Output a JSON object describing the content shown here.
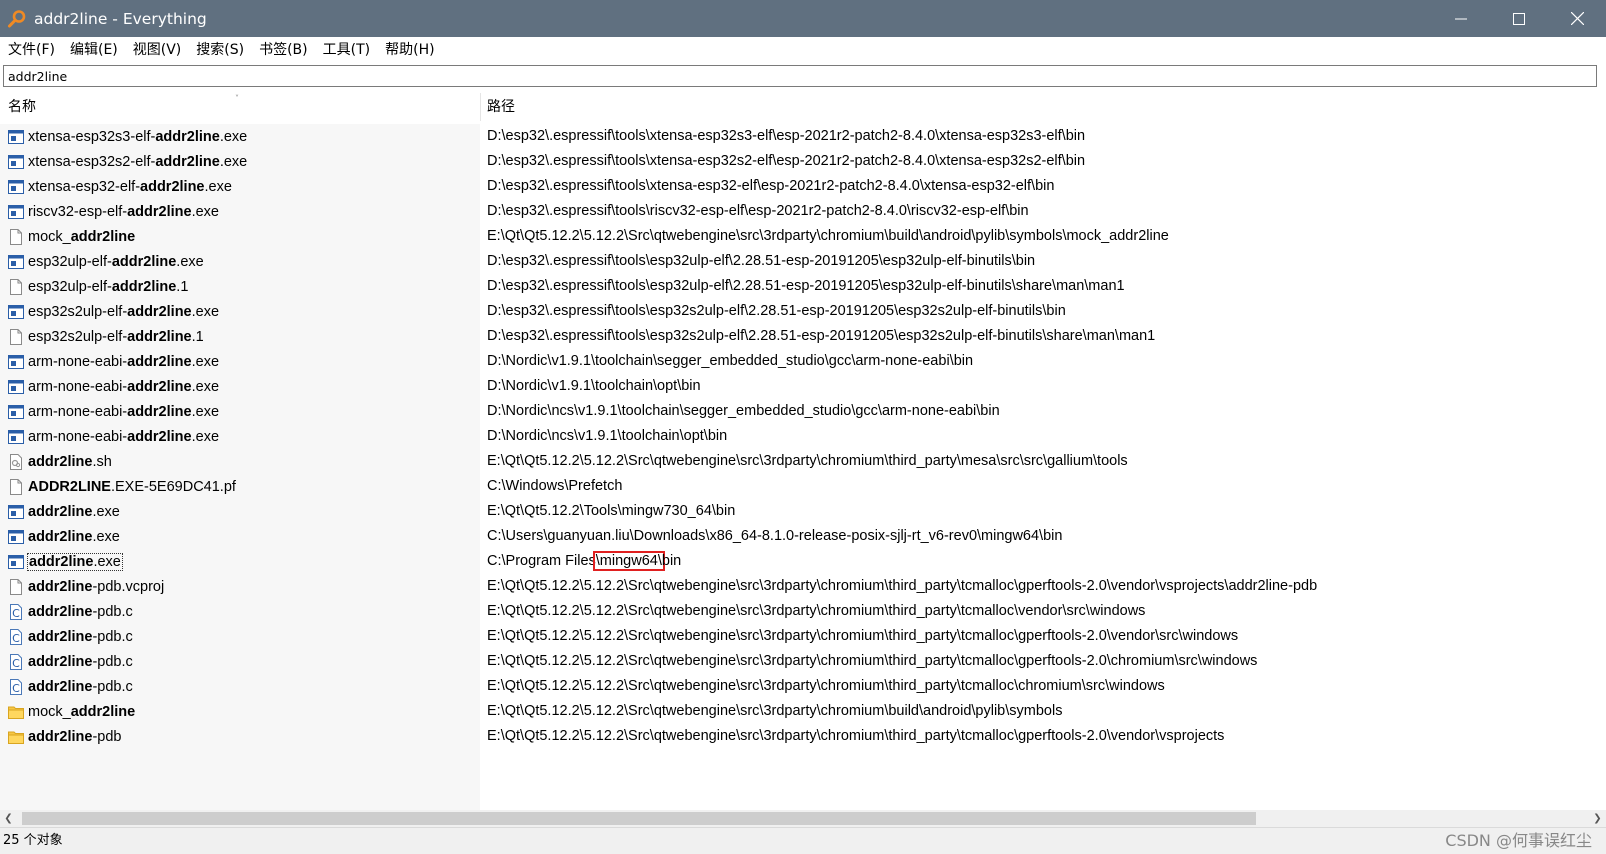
{
  "window": {
    "title": "addr2line - Everything"
  },
  "menu": [
    {
      "label": "文件(F)"
    },
    {
      "label": "编辑(E)"
    },
    {
      "label": "视图(V)"
    },
    {
      "label": "搜索(S)"
    },
    {
      "label": "书签(B)"
    },
    {
      "label": "工具(T)"
    },
    {
      "label": "帮助(H)"
    }
  ],
  "search": {
    "value": "addr2line"
  },
  "columns": {
    "name": "名称",
    "path": "路径"
  },
  "rows": [
    {
      "icon": "exe",
      "pre": "xtensa-esp32s3-elf-",
      "match": "addr2line",
      "post": ".exe",
      "path": "D:\\esp32\\.espressif\\tools\\xtensa-esp32s3-elf\\esp-2021r2-patch2-8.4.0\\xtensa-esp32s3-elf\\bin"
    },
    {
      "icon": "exe",
      "pre": "xtensa-esp32s2-elf-",
      "match": "addr2line",
      "post": ".exe",
      "path": "D:\\esp32\\.espressif\\tools\\xtensa-esp32s2-elf\\esp-2021r2-patch2-8.4.0\\xtensa-esp32s2-elf\\bin"
    },
    {
      "icon": "exe",
      "pre": "xtensa-esp32-elf-",
      "match": "addr2line",
      "post": ".exe",
      "path": "D:\\esp32\\.espressif\\tools\\xtensa-esp32-elf\\esp-2021r2-patch2-8.4.0\\xtensa-esp32-elf\\bin"
    },
    {
      "icon": "exe",
      "pre": "riscv32-esp-elf-",
      "match": "addr2line",
      "post": ".exe",
      "path": "D:\\esp32\\.espressif\\tools\\riscv32-esp-elf\\esp-2021r2-patch2-8.4.0\\riscv32-esp-elf\\bin"
    },
    {
      "icon": "file",
      "pre": "mock_",
      "match": "addr2line",
      "post": "",
      "path": "E:\\Qt\\Qt5.12.2\\5.12.2\\Src\\qtwebengine\\src\\3rdparty\\chromium\\build\\android\\pylib\\symbols\\mock_addr2line"
    },
    {
      "icon": "exe",
      "pre": "esp32ulp-elf-",
      "match": "addr2line",
      "post": ".exe",
      "path": "D:\\esp32\\.espressif\\tools\\esp32ulp-elf\\2.28.51-esp-20191205\\esp32ulp-elf-binutils\\bin"
    },
    {
      "icon": "file",
      "pre": "esp32ulp-elf-",
      "match": "addr2line",
      "post": ".1",
      "path": "D:\\esp32\\.espressif\\tools\\esp32ulp-elf\\2.28.51-esp-20191205\\esp32ulp-elf-binutils\\share\\man\\man1"
    },
    {
      "icon": "exe",
      "pre": "esp32s2ulp-elf-",
      "match": "addr2line",
      "post": ".exe",
      "path": "D:\\esp32\\.espressif\\tools\\esp32s2ulp-elf\\2.28.51-esp-20191205\\esp32s2ulp-elf-binutils\\bin"
    },
    {
      "icon": "file",
      "pre": "esp32s2ulp-elf-",
      "match": "addr2line",
      "post": ".1",
      "path": "D:\\esp32\\.espressif\\tools\\esp32s2ulp-elf\\2.28.51-esp-20191205\\esp32s2ulp-elf-binutils\\share\\man\\man1"
    },
    {
      "icon": "exe",
      "pre": "arm-none-eabi-",
      "match": "addr2line",
      "post": ".exe",
      "path": "D:\\Nordic\\v1.9.1\\toolchain\\segger_embedded_studio\\gcc\\arm-none-eabi\\bin"
    },
    {
      "icon": "exe",
      "pre": "arm-none-eabi-",
      "match": "addr2line",
      "post": ".exe",
      "path": "D:\\Nordic\\v1.9.1\\toolchain\\opt\\bin"
    },
    {
      "icon": "exe",
      "pre": "arm-none-eabi-",
      "match": "addr2line",
      "post": ".exe",
      "path": "D:\\Nordic\\ncs\\v1.9.1\\toolchain\\segger_embedded_studio\\gcc\\arm-none-eabi\\bin"
    },
    {
      "icon": "exe",
      "pre": "arm-none-eabi-",
      "match": "addr2line",
      "post": ".exe",
      "path": "D:\\Nordic\\ncs\\v1.9.1\\toolchain\\opt\\bin"
    },
    {
      "icon": "script",
      "pre": "",
      "match": "addr2line",
      "post": ".sh",
      "path": "E:\\Qt\\Qt5.12.2\\5.12.2\\Src\\qtwebengine\\src\\3rdparty\\chromium\\third_party\\mesa\\src\\src\\gallium\\tools"
    },
    {
      "icon": "file",
      "pre": "",
      "match": "ADDR2LINE",
      "post": ".EXE-5E69DC41.pf",
      "path": "C:\\Windows\\Prefetch"
    },
    {
      "icon": "exe",
      "pre": "",
      "match": "addr2line",
      "post": ".exe",
      "path": "E:\\Qt\\Qt5.12.2\\Tools\\mingw730_64\\bin"
    },
    {
      "icon": "exe",
      "pre": "",
      "match": "addr2line",
      "post": ".exe",
      "path": "C:\\Users\\guanyuan.liu\\Downloads\\x86_64-8.1.0-release-posix-sjlj-rt_v6-rev0\\mingw64\\bin"
    },
    {
      "icon": "exe",
      "pre": "",
      "match": "addr2line",
      "post": ".exe",
      "focused": true,
      "path": "C:\\Program Files\\mingw64\\bin",
      "path_pre": "C:\\Program Files",
      "path_hl": "\\mingw64\\",
      "path_post": "bin"
    },
    {
      "icon": "file",
      "pre": "",
      "match": "addr2line",
      "post": "-pdb.vcproj",
      "path": "E:\\Qt\\Qt5.12.2\\5.12.2\\Src\\qtwebengine\\src\\3rdparty\\chromium\\third_party\\tcmalloc\\gperftools-2.0\\vendor\\vsprojects\\addr2line-pdb"
    },
    {
      "icon": "c",
      "pre": "",
      "match": "addr2line",
      "post": "-pdb.c",
      "path": "E:\\Qt\\Qt5.12.2\\5.12.2\\Src\\qtwebengine\\src\\3rdparty\\chromium\\third_party\\tcmalloc\\vendor\\src\\windows"
    },
    {
      "icon": "c",
      "pre": "",
      "match": "addr2line",
      "post": "-pdb.c",
      "path": "E:\\Qt\\Qt5.12.2\\5.12.2\\Src\\qtwebengine\\src\\3rdparty\\chromium\\third_party\\tcmalloc\\gperftools-2.0\\vendor\\src\\windows"
    },
    {
      "icon": "c",
      "pre": "",
      "match": "addr2line",
      "post": "-pdb.c",
      "path": "E:\\Qt\\Qt5.12.2\\5.12.2\\Src\\qtwebengine\\src\\3rdparty\\chromium\\third_party\\tcmalloc\\gperftools-2.0\\chromium\\src\\windows"
    },
    {
      "icon": "c",
      "pre": "",
      "match": "addr2line",
      "post": "-pdb.c",
      "path": "E:\\Qt\\Qt5.12.2\\5.12.2\\Src\\qtwebengine\\src\\3rdparty\\chromium\\third_party\\tcmalloc\\chromium\\src\\windows"
    },
    {
      "icon": "folder",
      "pre": "mock_",
      "match": "addr2line",
      "post": "",
      "path": "E:\\Qt\\Qt5.12.2\\5.12.2\\Src\\qtwebengine\\src\\3rdparty\\chromium\\build\\android\\pylib\\symbols"
    },
    {
      "icon": "folder",
      "pre": "",
      "match": "addr2line",
      "post": "-pdb",
      "path": "E:\\Qt\\Qt5.12.2\\5.12.2\\Src\\qtwebengine\\src\\3rdparty\\chromium\\third_party\\tcmalloc\\gperftools-2.0\\vendor\\vsprojects"
    }
  ],
  "status": {
    "count": "25 个对象",
    "watermark": "CSDN @何事误红尘"
  },
  "scroll": {
    "h_thumb_fraction": 0.79
  },
  "colors": {
    "titlebar": "#607080",
    "highlight_box": "#e02020",
    "name_column_bg": "#f7f7f7"
  }
}
